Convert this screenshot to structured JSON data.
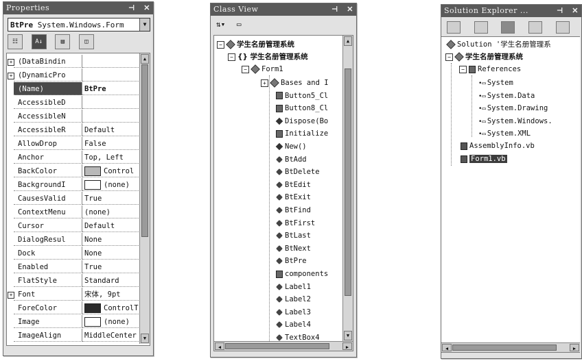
{
  "properties": {
    "title": "Properties",
    "pin": "⊣",
    "close": "✕",
    "object_name": "BtPre",
    "object_type": "System.Windows.Form",
    "toolbar": [
      "categorized",
      "alphabetic",
      "properties",
      "events"
    ],
    "rows": [
      {
        "expand": true,
        "name": "(DataBindin",
        "value": ""
      },
      {
        "expand": true,
        "name": "(DynamicPro",
        "value": ""
      },
      {
        "expand": false,
        "name": "(Name)",
        "value": "BtPre",
        "selected": true
      },
      {
        "expand": false,
        "name": "AccessibleD",
        "value": ""
      },
      {
        "expand": false,
        "name": "AccessibleN",
        "value": ""
      },
      {
        "expand": false,
        "name": "AccessibleR",
        "value": "Default"
      },
      {
        "expand": false,
        "name": "AllowDrop",
        "value": "False"
      },
      {
        "expand": false,
        "name": "Anchor",
        "value": "Top, Left"
      },
      {
        "expand": false,
        "name": "BackColor",
        "value": "Control",
        "swatch": "#b8b8b8"
      },
      {
        "expand": false,
        "name": "BackgroundI",
        "value": "(none)",
        "swatch": "#ffffff"
      },
      {
        "expand": false,
        "name": "CausesValid",
        "value": "True"
      },
      {
        "expand": false,
        "name": "ContextMenu",
        "value": "(none)"
      },
      {
        "expand": false,
        "name": "Cursor",
        "value": "Default"
      },
      {
        "expand": false,
        "name": "DialogResul",
        "value": "None"
      },
      {
        "expand": false,
        "name": "Dock",
        "value": "None"
      },
      {
        "expand": false,
        "name": "Enabled",
        "value": "True"
      },
      {
        "expand": false,
        "name": "FlatStyle",
        "value": "Standard"
      },
      {
        "expand": true,
        "name": "Font",
        "value": "宋体, 9pt"
      },
      {
        "expand": false,
        "name": "ForeColor",
        "value": "ControlT",
        "swatch": "#2a2a2a"
      },
      {
        "expand": false,
        "name": "Image",
        "value": "(none)",
        "swatch": "#ffffff"
      },
      {
        "expand": false,
        "name": "ImageAlign",
        "value": "MiddleCenter"
      }
    ]
  },
  "class_view": {
    "title": "Class View",
    "pin": "⊣",
    "close": "✕",
    "root": "学生名册管理系统",
    "namespace": "{} 学生名册管理系统",
    "form": "Form1",
    "members": [
      {
        "label": "Bases and I",
        "icon": "box"
      },
      {
        "label": "Button5_Cl",
        "icon": "lock"
      },
      {
        "label": "Button8_Cl",
        "icon": "lock"
      },
      {
        "label": "Dispose(Bo",
        "icon": "method"
      },
      {
        "label": "Initialize",
        "icon": "lock"
      },
      {
        "label": "New()",
        "icon": "method"
      },
      {
        "label": "BtAdd",
        "icon": "field"
      },
      {
        "label": "BtDelete",
        "icon": "field"
      },
      {
        "label": "BtEdit",
        "icon": "field"
      },
      {
        "label": "BtExit",
        "icon": "field"
      },
      {
        "label": "BtFind",
        "icon": "field"
      },
      {
        "label": "BtFirst",
        "icon": "field"
      },
      {
        "label": "BtLast",
        "icon": "field"
      },
      {
        "label": "BtNext",
        "icon": "field"
      },
      {
        "label": "BtPre",
        "icon": "field"
      },
      {
        "label": "components",
        "icon": "lock"
      },
      {
        "label": "Label1",
        "icon": "field"
      },
      {
        "label": "Label2",
        "icon": "field"
      },
      {
        "label": "Label3",
        "icon": "field"
      },
      {
        "label": "Label4",
        "icon": "field"
      },
      {
        "label": "TextBox4",
        "icon": "field"
      }
    ]
  },
  "solution_explorer": {
    "title": "Solution Explorer ...",
    "pin": "⊣",
    "close": "✕",
    "solution": "Solution '学生名册管理系",
    "project": "学生名册管理系统",
    "references_label": "References",
    "references": [
      "System",
      "System.Data",
      "System.Drawing",
      "System.Windows.",
      "System.XML"
    ],
    "files": [
      {
        "label": "AssemblyInfo.vb",
        "selected": false
      },
      {
        "label": "Form1.vb",
        "selected": true
      }
    ]
  }
}
